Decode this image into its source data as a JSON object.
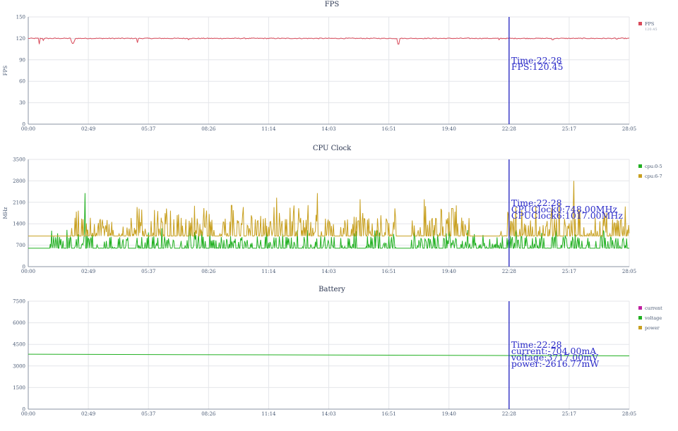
{
  "chart_data": [
    {
      "id": "fps",
      "type": "line",
      "title": "FPS",
      "ylabel": "FPS",
      "ylim": [
        0,
        150
      ],
      "yticks": [
        "0",
        "30",
        "60",
        "90",
        "120",
        "150"
      ],
      "xticks": [
        "00:00",
        "02:49",
        "05:37",
        "08:26",
        "11:14",
        "14:03",
        "16:51",
        "19:40",
        "22:28",
        "25:17",
        "28:05"
      ],
      "x_range_minutes": [
        0,
        28.083
      ],
      "grid": true,
      "legend_position": "right",
      "legend": [
        {
          "name": "FPS",
          "color": "#d94a5a",
          "sub": "120.45"
        }
      ],
      "series": [
        {
          "name": "FPS",
          "color": "#d94a5a",
          "baseline": 120,
          "dips": [
            [
              0.5,
              112
            ],
            [
              0.7,
              117
            ],
            [
              2.0,
              116
            ],
            [
              2.05,
              113
            ],
            [
              2.1,
              113
            ],
            [
              2.15,
              116
            ],
            [
              5.1,
              114
            ],
            [
              7.5,
              118
            ],
            [
              17.3,
              112
            ],
            [
              22.0,
              118
            ],
            [
              24.5,
              118
            ],
            [
              27.5,
              119
            ]
          ]
        }
      ],
      "cursor": {
        "time": "22:28",
        "lines": [
          "Time:22:28",
          "FPS:120.45"
        ]
      }
    },
    {
      "id": "cpu",
      "type": "line",
      "title": "CPU Clock",
      "ylabel": "MHz",
      "ylim": [
        0,
        3500
      ],
      "yticks": [
        "0",
        "700",
        "1400",
        "2100",
        "2800",
        "3500"
      ],
      "xticks": [
        "00:00",
        "02:49",
        "05:37",
        "08:26",
        "11:14",
        "14:03",
        "16:51",
        "19:40",
        "22:28",
        "25:17",
        "28:05"
      ],
      "x_range_minutes": [
        0,
        28.083
      ],
      "grid": true,
      "legend_position": "right",
      "legend": [
        {
          "name": "cpu:0-5",
          "color": "#22b022"
        },
        {
          "name": "cpu:6-7",
          "color": "#c8a020"
        }
      ],
      "series": [
        {
          "name": "cpu:0-5",
          "color": "#22b022",
          "baseline": 600,
          "noise_high": 1000,
          "spikes": [
            [
              2.65,
              2400
            ],
            [
              1.8,
              1200
            ],
            [
              3.0,
              1100
            ],
            [
              22.8,
              1200
            ],
            [
              24.0,
              1100
            ]
          ]
        },
        {
          "name": "cpu:6-7",
          "color": "#c8a020",
          "baseline": 1000,
          "noise_high": 1600,
          "spikes": [
            [
              11.6,
              2250
            ],
            [
              13.5,
              2400
            ],
            [
              15.5,
              2200
            ],
            [
              18.5,
              2200
            ],
            [
              24.8,
              2100
            ],
            [
              25.5,
              2800
            ],
            [
              19.8,
              1900
            ],
            [
              9.5,
              2000
            ]
          ]
        }
      ],
      "cursor": {
        "time": "22:28",
        "lines": [
          "Time:22:28",
          "CPUClock0:748.00MHz",
          "CPUClock6:1017.00MHz"
        ]
      }
    },
    {
      "id": "battery",
      "type": "line",
      "title": "Battery",
      "ylabel": "",
      "ylim": [
        0,
        7500
      ],
      "yticks": [
        "0",
        "1500",
        "3000",
        "4500",
        "6000",
        "7500"
      ],
      "xticks": [
        "00:00",
        "02:49",
        "05:37",
        "08:26",
        "11:14",
        "14:03",
        "16:51",
        "19:40",
        "22:28",
        "25:17",
        "28:05"
      ],
      "x_range_minutes": [
        0,
        28.083
      ],
      "grid": true,
      "legend_position": "right",
      "legend": [
        {
          "name": "current",
          "color": "#c020a0"
        },
        {
          "name": "voltage",
          "color": "#22b022"
        },
        {
          "name": "power",
          "color": "#c8a020"
        }
      ],
      "series": [
        {
          "name": "voltage",
          "color": "#22b022",
          "x": [
            0,
            28.083
          ],
          "values": [
            3820,
            3700
          ]
        }
      ],
      "cursor": {
        "time": "22:28",
        "lines": [
          "Time:22:28",
          "current:-704.00mA",
          "voltage:3717.00mV",
          "power:-2616.77mW"
        ]
      }
    }
  ]
}
